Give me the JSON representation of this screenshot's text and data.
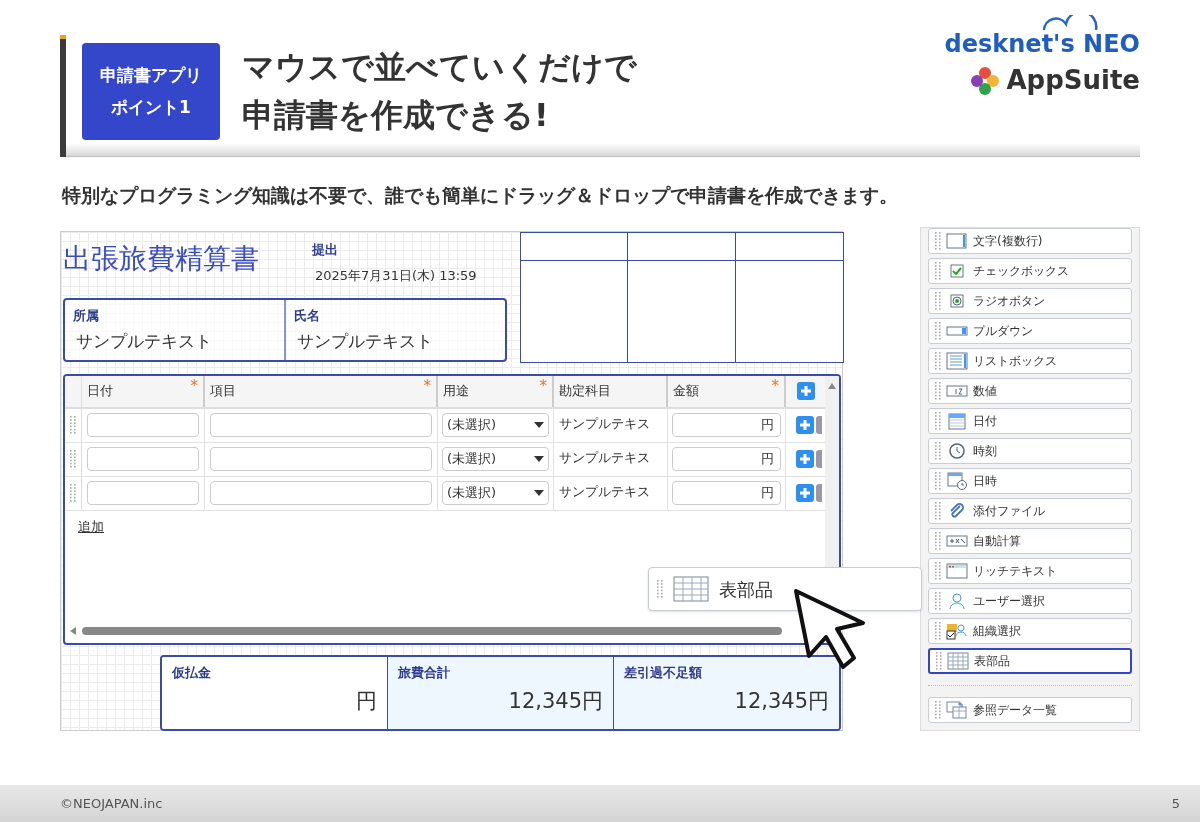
{
  "badge": {
    "lines": [
      "申請書アプリ",
      "ポイント1"
    ]
  },
  "headline": {
    "lines": [
      "マウスで並べていくだけで",
      "申請書を作成できる!"
    ]
  },
  "logo": {
    "brand": "desknet's NEO",
    "product": "AppSuite"
  },
  "subtitle": "特別なプログラミング知識は不要で、誰でも簡単にドラッグ＆ドロップで申請書を作成できます。",
  "form": {
    "title": "出張旅費精算書",
    "submitted": {
      "label": "提出",
      "value": "2025年7月31日(木) 13:59"
    },
    "fields": [
      {
        "label": "所属",
        "value": "サンプルテキスト"
      },
      {
        "label": "氏名",
        "value": "サンプルテキスト"
      }
    ],
    "table": {
      "columns": [
        {
          "label": "日付",
          "required_mark": "*"
        },
        {
          "label": "項目",
          "required_mark": "*"
        },
        {
          "label": "用途",
          "required_mark": "*"
        },
        {
          "label": "勘定科目"
        },
        {
          "label": "金額",
          "required_mark": "*"
        }
      ],
      "rows": [
        {
          "purpose": "(未選択)",
          "account": "サンプルテキス",
          "unit": "円"
        },
        {
          "purpose": "(未選択)",
          "account": "サンプルテキス",
          "unit": "円"
        },
        {
          "purpose": "(未選択)",
          "account": "サンプルテキス",
          "unit": "円"
        }
      ],
      "add_link": "追加"
    },
    "totals": [
      {
        "label": "仮払金",
        "value": "円",
        "highlighted": false
      },
      {
        "label": "旅費合計",
        "value": "12,345円",
        "highlighted": true
      },
      {
        "label": "差引過不足額",
        "value": "12,345円",
        "highlighted": true
      }
    ]
  },
  "palette": {
    "items": [
      {
        "label": "文字(複数行)",
        "kind": "textarea",
        "selected": false
      },
      {
        "label": "チェックボックス",
        "kind": "checkbox",
        "selected": false
      },
      {
        "label": "ラジオボタン",
        "kind": "radio",
        "selected": false
      },
      {
        "label": "プルダウン",
        "kind": "pulldown",
        "selected": false
      },
      {
        "label": "リストボックス",
        "kind": "listbox",
        "selected": false
      },
      {
        "label": "数値",
        "kind": "number",
        "selected": false
      },
      {
        "label": "日付",
        "kind": "date",
        "selected": false
      },
      {
        "label": "時刻",
        "kind": "time",
        "selected": false
      },
      {
        "label": "日時",
        "kind": "datetime",
        "selected": false
      },
      {
        "label": "添付ファイル",
        "kind": "attachment",
        "selected": false
      },
      {
        "label": "自動計算",
        "kind": "calc",
        "selected": false
      },
      {
        "label": "リッチテキスト",
        "kind": "richtext",
        "selected": false
      },
      {
        "label": "ユーザー選択",
        "kind": "user",
        "selected": false
      },
      {
        "label": "組織選択",
        "kind": "org",
        "selected": false
      },
      {
        "label": "表部品",
        "kind": "table",
        "selected": true
      },
      {
        "label": "参照データ一覧",
        "kind": "reference",
        "selected": false,
        "separated": true
      }
    ]
  },
  "drag_item": {
    "label": "表部品"
  },
  "footer": {
    "copyright": "©NEOJAPAN.inc",
    "page": "5"
  }
}
